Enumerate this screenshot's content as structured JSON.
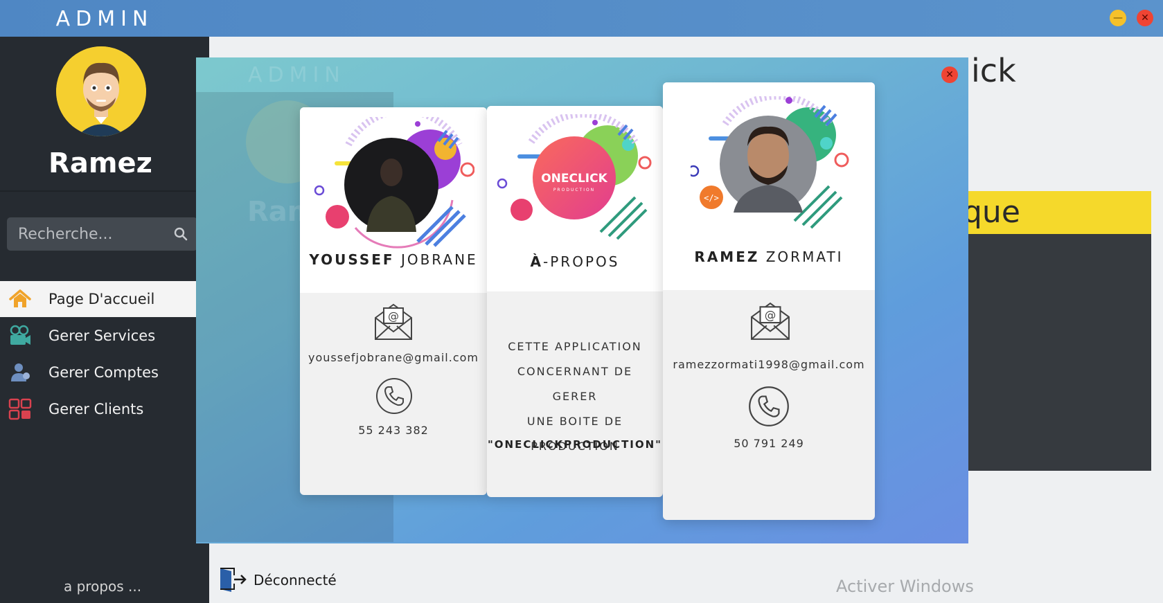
{
  "window": {
    "brand": "ADMIN",
    "minimize_glyph": "—",
    "close_glyph": "✕"
  },
  "sidebar": {
    "user_name": "Ramez",
    "search_placeholder": "Recherche...",
    "items": [
      {
        "label": "Page D'accueil",
        "icon": "home-icon",
        "active": true
      },
      {
        "label": "Gerer Services",
        "icon": "camera-icon",
        "active": false
      },
      {
        "label": "Gerer Comptes",
        "icon": "user-icon",
        "active": false
      },
      {
        "label": "Gerer Clients",
        "icon": "clients-icon",
        "active": false
      }
    ],
    "about_link": "a propos ..."
  },
  "main": {
    "background_title_fragment": "ick",
    "background_band_fragment": "que",
    "logout_label": "Déconnecté",
    "watermark": "Activer Windows"
  },
  "modal": {
    "ghost_brand": "ADMIN",
    "ghost_name": "Ram",
    "close_glyph": "✕",
    "cards": {
      "youssef": {
        "first": "YOUSSEF",
        "last": "JOBRANE",
        "email": "youssefjobrane@gmail.com",
        "phone": "55 243 382"
      },
      "about": {
        "title_bold": "À",
        "title_rest": "-PROPOS",
        "logo_text": "ONECLICK",
        "logo_sub": "PRODUCTION",
        "lines": [
          "CETTE APPLICATION",
          "CONCERNANT DE GERER",
          "UNE BOITE DE",
          "PRODUCTION"
        ],
        "brand": "\"ONECLICKPRODUCTION\""
      },
      "ramez": {
        "first": "RAMEZ",
        "last": "ZORMATI",
        "email": "ramezzormati1998@gmail.com",
        "phone": "50 791 249"
      }
    }
  },
  "colors": {
    "titlebar": "#5b93cc",
    "sidebar": "#262b31",
    "accent_yellow": "#f5d92b",
    "close_red": "#ef4433",
    "minimize_yellow": "#f6c12a"
  }
}
